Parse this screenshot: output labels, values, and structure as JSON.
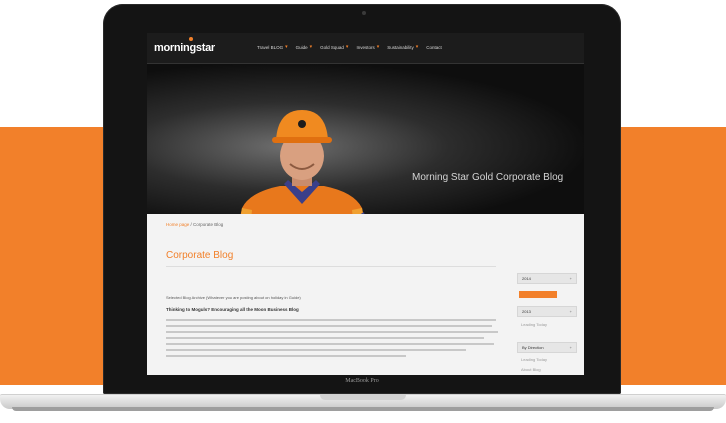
{
  "site": {
    "logo_text": "morningstar",
    "nav": [
      {
        "label": "Travel BLOG"
      },
      {
        "label": "Guide"
      },
      {
        "label": "Gold Squad"
      },
      {
        "label": "Investors"
      },
      {
        "label": "Sustainability"
      },
      {
        "label": "Contact"
      }
    ]
  },
  "hero": {
    "title": "Morning Star Gold Corporate Blog"
  },
  "content": {
    "breadcrumb_link": "Home page",
    "breadcrumb_current": "Corporate Blog",
    "page_title": "Corporate Blog",
    "post_meta": "Selected Blog Archive (Whatever you are posting about on holiday in Guide)",
    "post_heading": "Thinking to Moguls? Encouraging all the Moon Business Blog"
  },
  "sidebar": {
    "rows": [
      {
        "label": "2014"
      },
      {
        "label": "2013"
      },
      {
        "label": "By Direction"
      }
    ],
    "subs": [
      "Leading Today",
      "Leading Today",
      "About Blog"
    ]
  },
  "device": {
    "label": "MacBook Pro"
  },
  "colors": {
    "accent": "#f2802a"
  }
}
